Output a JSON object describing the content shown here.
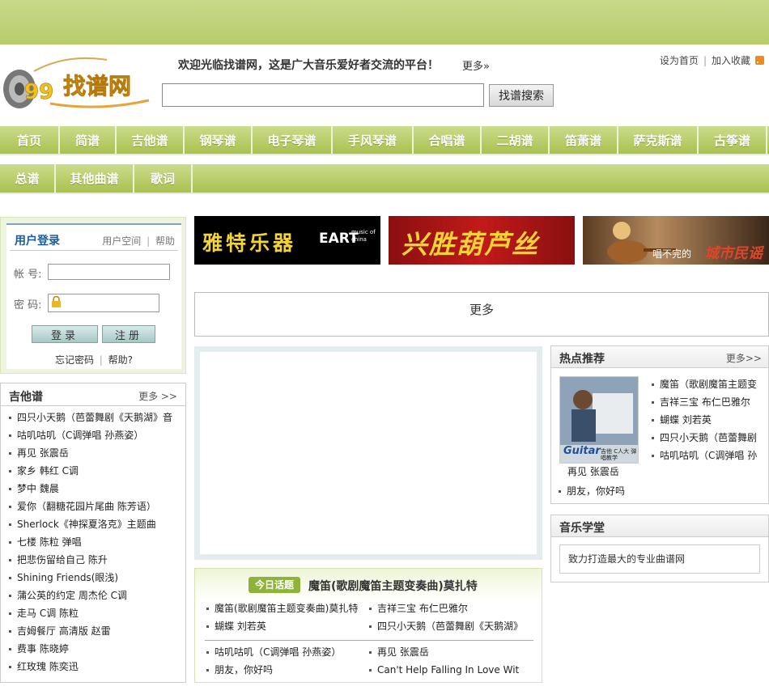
{
  "header": {
    "welcome": "欢迎光临找谱网，这是广大音乐爱好者交流的平台！",
    "welcome_more": "更多»",
    "set_home": "设为首页",
    "add_fav": "加入收藏",
    "link_sep": "|",
    "search_placeholder": "",
    "search_button": "找谱搜索"
  },
  "logo": {
    "text": "找谱网",
    "number": "99"
  },
  "nav": {
    "row1": [
      "首页",
      "简谱",
      "吉他谱",
      "钢琴谱",
      "电子琴谱",
      "手风琴谱",
      "合唱谱",
      "二胡谱",
      "笛萧谱",
      "萨克斯谱",
      "古筝谱"
    ],
    "row2": [
      "总谱",
      "其他曲谱",
      "歌词"
    ]
  },
  "login": {
    "title": "用户登录",
    "space": "用户空间",
    "sep": "|",
    "help": "帮助",
    "account_label": "帐 号:",
    "password_label": "密 码:",
    "account_value": "",
    "password_value": "",
    "login_button": "登录",
    "register_button": "注册",
    "forgot": "忘记密码",
    "help2": "帮助?"
  },
  "banners": {
    "b1_text": "雅特乐器",
    "b1_brand": "EART",
    "b1_sub": "music of china",
    "b2_text": "兴胜葫芦丝",
    "b3_text": "唱不完的",
    "b3_text2": "城市民谣"
  },
  "more_box": "更多",
  "guitar": {
    "title": "吉他谱",
    "more": "更多 >>",
    "items": [
      "四只小天鹅（芭蕾舞剧《天鹅湖》音",
      "咕叽咕叽（C调弹唱 孙燕姿）",
      "再见 张震岳",
      "家乡 韩红 C调",
      "梦中 魏晨",
      "爱你（翻糖花园片尾曲 陈芳语）",
      "Sherlock《神探夏洛克》主题曲",
      "七楼 陈粒 弹唱",
      "把悲伤留给自己 陈升",
      "Shining Friends(眼浅)",
      "蒲公英的约定 周杰伦 C调",
      "走马 C调 陈粒",
      "吉姆餐厅 高清版 赵雷",
      "费事 陈晓婷",
      "红玫瑰 陈奕迅"
    ]
  },
  "today": {
    "badge": "今日话题",
    "title": "魔笛(歌剧魔笛主题变奏曲)莫扎特",
    "left": [
      "魔笛(歌剧魔笛主题变奏曲)莫扎特",
      "蝴蝶 刘若英"
    ],
    "right": [
      "吉祥三宝 布仁巴雅尔",
      "四只小天鹅（芭蕾舞剧《天鹅湖》"
    ],
    "left2": [
      "咕叽咕叽（C调弹唱 孙燕姿）",
      "朋友，你好吗"
    ],
    "right2": [
      "再见 张震岳",
      "Can't Help Falling In Love Wit"
    ]
  },
  "hot": {
    "title": "热点推荐",
    "more": "更多>>",
    "thumb_text": "Guitar",
    "thumb_caption": "吉他 C人大 弹唱教学",
    "items": [
      "魔笛（歌剧魔笛主题变",
      "吉祥三宝 布仁巴雅尔",
      "蝴蝶 刘若英",
      "四只小天鹅（芭蕾舞剧",
      "咕叽咕叽（C调弹唱 孙"
    ],
    "extra1": "再见 张震岳",
    "extra2": "朋友，你好吗"
  },
  "school": {
    "title": "音乐学堂",
    "text": "致力打造最大的专业曲谱网"
  }
}
